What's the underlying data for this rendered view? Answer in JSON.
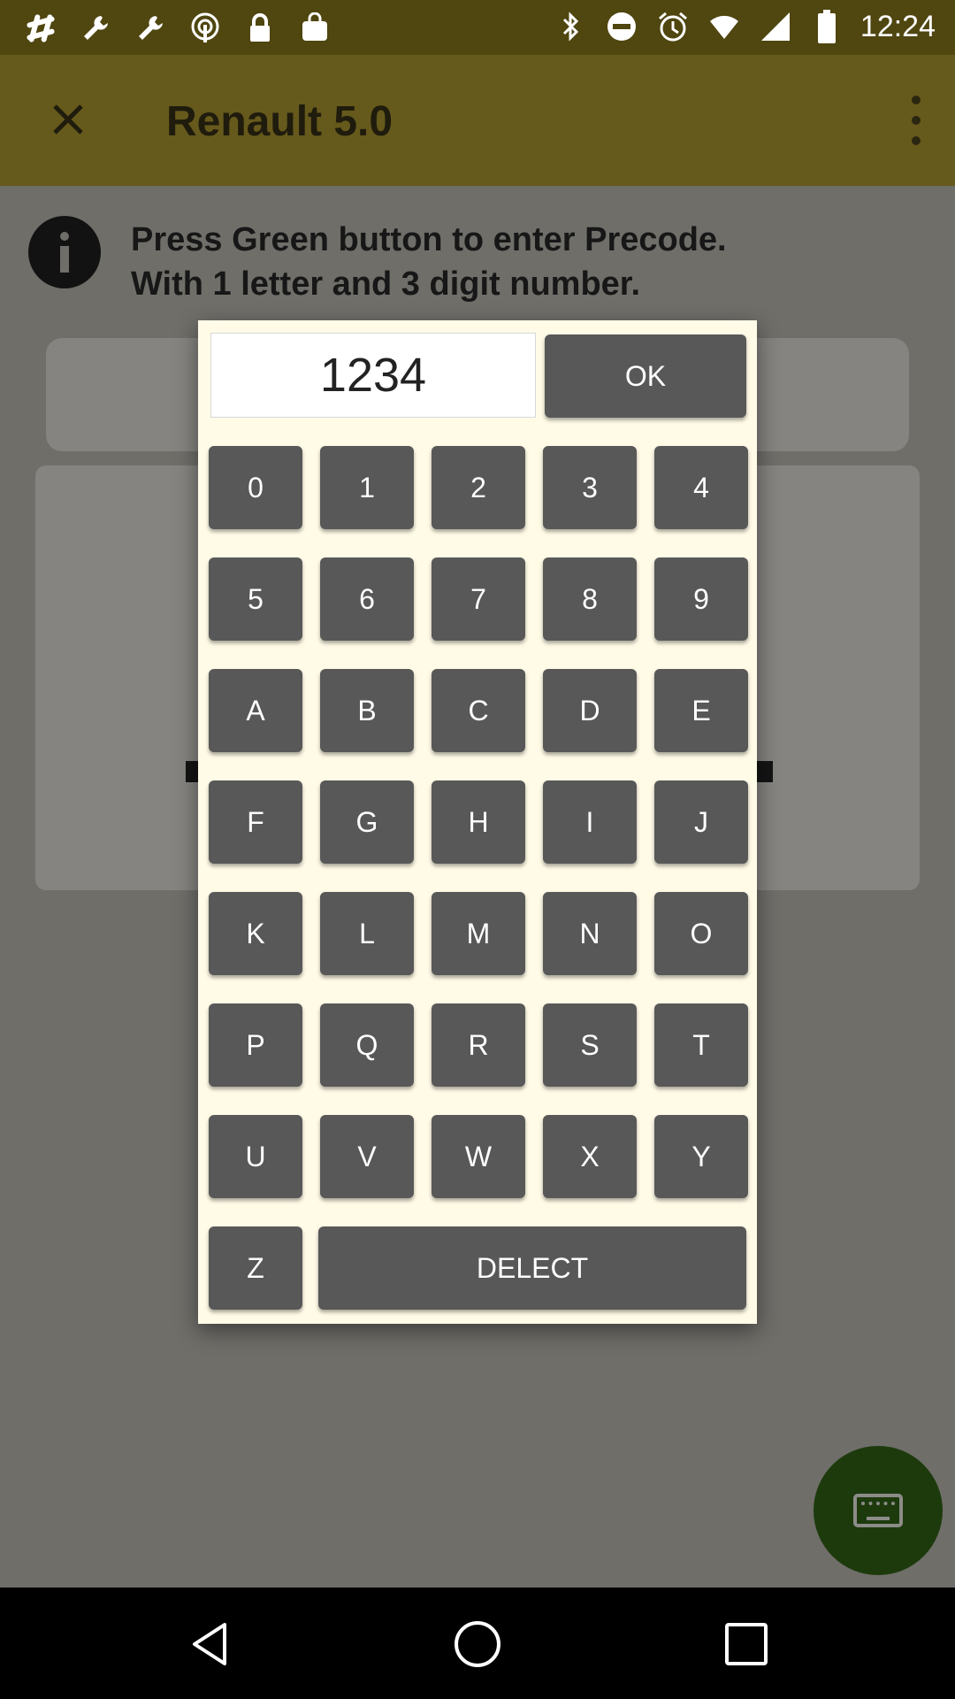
{
  "status_bar": {
    "time": "12:24",
    "left_icons": [
      "slack-icon",
      "wrench-icon",
      "wrench-icon",
      "podcast-icon",
      "lock-icon",
      "bag-icon"
    ],
    "right_icons": [
      "bluetooth-icon",
      "do-not-disturb-icon",
      "alarm-icon",
      "wifi-icon",
      "signal-icon",
      "battery-icon"
    ]
  },
  "app_bar": {
    "title": "Renault 5.0",
    "close_icon": "close-icon",
    "menu_icon": "more-vert-icon"
  },
  "content": {
    "instruction": "Press Green button to enter Precode.\nWith 1 letter and 3 digit number."
  },
  "dialog": {
    "code_value": "1234",
    "ok_label": "OK",
    "keys": [
      "0",
      "1",
      "2",
      "3",
      "4",
      "5",
      "6",
      "7",
      "8",
      "9",
      "A",
      "B",
      "C",
      "D",
      "E",
      "F",
      "G",
      "H",
      "I",
      "J",
      "K",
      "L",
      "M",
      "N",
      "O",
      "P",
      "Q",
      "R",
      "S",
      "T",
      "U",
      "V",
      "W",
      "X",
      "Y",
      "Z"
    ],
    "delect_label": "DELECT"
  },
  "fab_icon": "keyboard-icon",
  "colors": {
    "app_bar": "#66591c",
    "status_bar": "#4f4610",
    "key": "#585858",
    "dialog_bg": "#fffbe7",
    "fab": "#1d3a0d"
  }
}
